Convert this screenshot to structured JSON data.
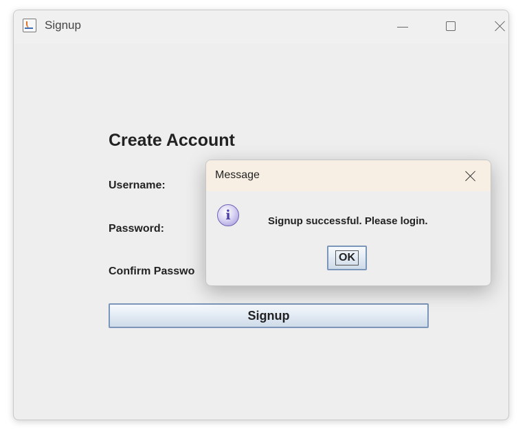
{
  "window": {
    "title": "Signup",
    "icon": "java-cup-icon"
  },
  "form": {
    "heading": "Create Account",
    "username_label": "Username:",
    "password_label": "Password:",
    "confirm_label": "Confirm Passwo",
    "signup_label": "Signup"
  },
  "dialog": {
    "title": "Message",
    "icon": "information-icon",
    "icon_glyph": "i",
    "message": "Signup successful. Please login.",
    "ok_label": "OK"
  }
}
